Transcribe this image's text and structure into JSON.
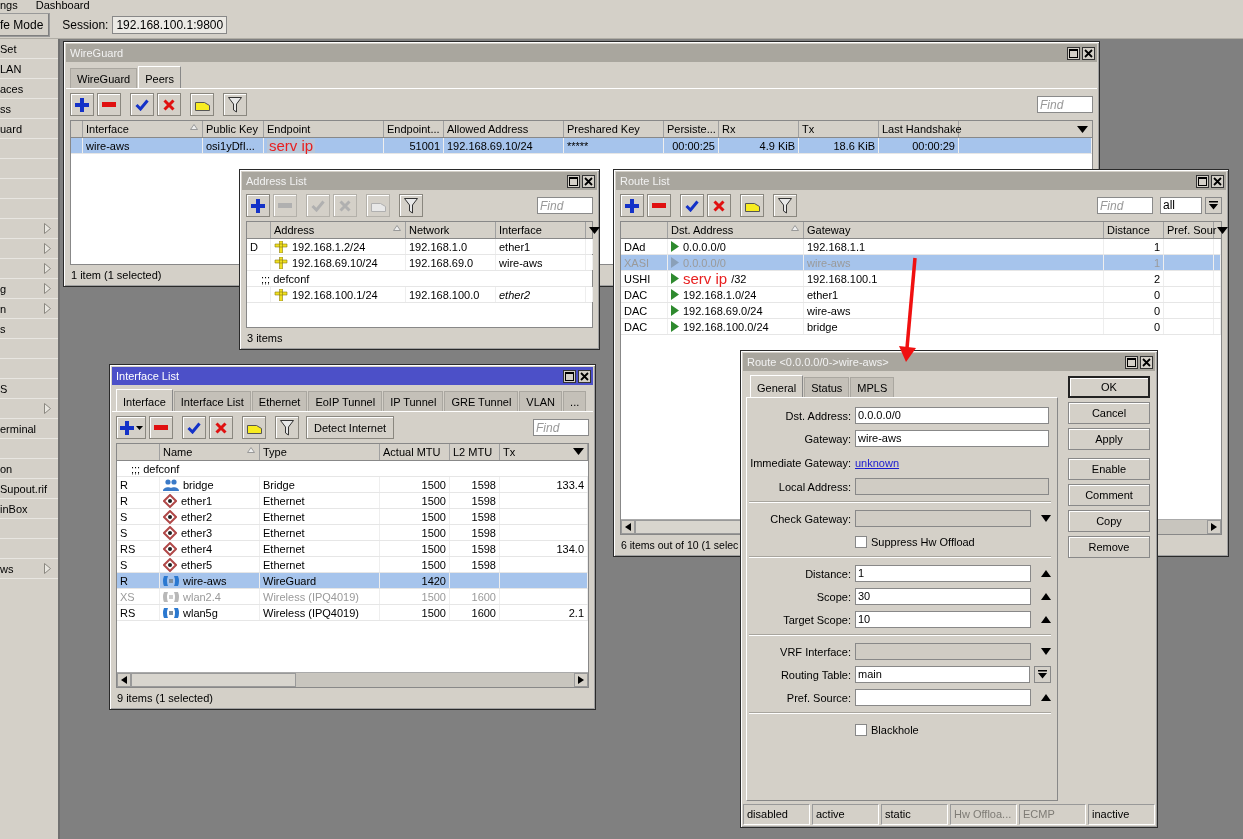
{
  "menu_bar": [
    "ngs",
    "Dashboard"
  ],
  "toolbar": {
    "safe_mode": "fe Mode",
    "session_label": "Session:",
    "session": "192.168.100.1:9800"
  },
  "sidebar": {
    "items": [
      {
        "label": "Set",
        "submenu": false
      },
      {
        "label": "LAN",
        "submenu": false
      },
      {
        "label": "aces",
        "submenu": false
      },
      {
        "label": "ss",
        "submenu": false
      },
      {
        "label": "uard",
        "submenu": false
      },
      {
        "submenu": false
      },
      {
        "submenu": false
      },
      {
        "submenu": false
      },
      {
        "submenu": false
      },
      {
        "submenu": true
      },
      {
        "submenu": true
      },
      {
        "submenu": true
      },
      {
        "label": "g",
        "submenu": true
      },
      {
        "label": "n",
        "submenu": true
      },
      {
        "label": "s",
        "submenu": false
      },
      {
        "submenu": false
      },
      {
        "submenu": false
      },
      {
        "label": "S",
        "submenu": false
      },
      {
        "submenu": true
      },
      {
        "label": "erminal",
        "submenu": false
      },
      {
        "submenu": false
      },
      {
        "label": "on",
        "submenu": false
      },
      {
        "label": "Supout.rif",
        "submenu": false
      },
      {
        "label": "inBox",
        "submenu": false
      },
      {
        "submenu": false
      },
      {
        "submenu": false
      },
      {
        "label": "ws",
        "submenu": true
      }
    ]
  },
  "wireguard_window": {
    "title": "WireGuard",
    "active": false,
    "tabs": [
      {
        "label": "WireGuard",
        "selected": false
      },
      {
        "label": "Peers",
        "selected": true
      }
    ],
    "toolbar": [
      {
        "kind": "add",
        "disabled": false
      },
      {
        "kind": "remove",
        "disabled": false
      },
      {
        "kind": "enable",
        "disabled": false
      },
      {
        "kind": "disable",
        "disabled": false
      },
      {
        "kind": "comment",
        "disabled": false
      },
      {
        "kind": "filter",
        "disabled": false
      }
    ],
    "find": {
      "placeholder": "Find"
    },
    "columns": [
      {
        "label": "Interface",
        "sorted": true
      },
      {
        "label": "Public Key",
        "sorted": false
      },
      {
        "label": "Endpoint",
        "sorted": false
      },
      {
        "label": "Endpoint...",
        "sorted": false
      },
      {
        "label": "Allowed Address",
        "sorted": false
      },
      {
        "label": "Preshared Key",
        "sorted": false
      },
      {
        "label": "Persiste...",
        "sorted": false
      },
      {
        "label": "Rx",
        "sorted": false
      },
      {
        "label": "Tx",
        "sorted": false
      },
      {
        "label": "Last Handshake",
        "sorted": false
      }
    ],
    "rows": [
      {
        "selected": true,
        "interface": "wire-aws",
        "public_key": "osi1yDfI...",
        "endpoint_annotation": "serv ip",
        "endpoint_port": "51001",
        "allowed_address": "192.168.69.10/24",
        "preshared_key": "*****",
        "persistent_keepalive": "00:00:25",
        "rx": "4.9 KiB",
        "tx": "18.6 KiB",
        "last_handshake": "00:00:29"
      }
    ],
    "status": "1 item (1 selected)"
  },
  "address_list_window": {
    "title": "Address List",
    "active": false,
    "toolbar": [
      {
        "kind": "add",
        "disabled": false
      },
      {
        "kind": "remove",
        "disabled": true
      },
      {
        "kind": "enable",
        "disabled": true
      },
      {
        "kind": "disable",
        "disabled": true
      },
      {
        "kind": "comment",
        "disabled": true
      },
      {
        "kind": "filter",
        "disabled": false
      }
    ],
    "find": {
      "placeholder": "Find"
    },
    "columns": [
      {
        "label": "Address",
        "sorted": true
      },
      {
        "label": "Network",
        "sorted": false
      },
      {
        "label": "Interface",
        "sorted": false
      }
    ],
    "rows": [
      {
        "kind": "entry",
        "flag": "D",
        "address": "192.168.1.2/24",
        "network": "192.168.1.0",
        "interface": "ether1",
        "invalid": false
      },
      {
        "kind": "entry",
        "address": "192.168.69.10/24",
        "network": "192.168.69.0",
        "interface": "wire-aws",
        "invalid": false
      },
      {
        "kind": "comment",
        "text": ";;; defconf"
      },
      {
        "kind": "entry",
        "address": "192.168.100.1/24",
        "network": "192.168.100.0",
        "interface": "ether2",
        "invalid": true
      }
    ],
    "status": "3 items"
  },
  "route_list_window": {
    "title": "Route List",
    "active": false,
    "toolbar": [
      {
        "kind": "add",
        "disabled": false
      },
      {
        "kind": "remove",
        "disabled": false
      },
      {
        "kind": "enable",
        "disabled": false
      },
      {
        "kind": "disable",
        "disabled": false
      },
      {
        "kind": "comment",
        "disabled": false
      },
      {
        "kind": "filter",
        "disabled": false
      }
    ],
    "find": {
      "placeholder": "Find"
    },
    "filter": {
      "value": "all"
    },
    "columns": [
      {
        "label": "Dst. Address",
        "sorted": true
      },
      {
        "label": "Gateway",
        "sorted": false
      },
      {
        "label": "Distance",
        "sorted": false
      },
      {
        "label": "Pref. Sour",
        "sorted": false
      }
    ],
    "rows": [
      {
        "flags": "DAd",
        "dst": "0.0.0.0/0",
        "gateway": "192.168.1.1",
        "distance": "1",
        "selected": false,
        "disabled": false
      },
      {
        "flags": "XASI",
        "dst": "0.0.0.0/0",
        "gateway": "wire-aws",
        "distance": "1",
        "selected": true,
        "disabled": true
      },
      {
        "flags": "USHI",
        "dst_annotation": "serv ip",
        "dst": "/32",
        "gateway": "192.168.100.1",
        "distance": "2",
        "selected": false,
        "disabled": false
      },
      {
        "flags": "DAC",
        "dst": "192.168.1.0/24",
        "gateway": "ether1",
        "distance": "0",
        "selected": false,
        "disabled": false
      },
      {
        "flags": "DAC",
        "dst": "192.168.69.0/24",
        "gateway": "wire-aws",
        "distance": "0",
        "selected": false,
        "disabled": false
      },
      {
        "flags": "DAC",
        "dst": "192.168.100.0/24",
        "gateway": "bridge",
        "distance": "0",
        "selected": false,
        "disabled": false
      }
    ],
    "status": "6 items out of 10 (1 selec"
  },
  "interface_list_window": {
    "title": "Interface List",
    "active": true,
    "tabs": [
      {
        "label": "Interface",
        "selected": true
      },
      {
        "label": "Interface List",
        "selected": false
      },
      {
        "label": "Ethernet",
        "selected": false
      },
      {
        "label": "EoIP Tunnel",
        "selected": false
      },
      {
        "label": "IP Tunnel",
        "selected": false
      },
      {
        "label": "GRE Tunnel",
        "selected": false
      },
      {
        "label": "VLAN",
        "selected": false
      },
      {
        "label": "...",
        "selected": false
      }
    ],
    "toolbar": [
      {
        "kind": "add",
        "disabled": false
      },
      {
        "kind": "remove",
        "disabled": false
      },
      {
        "kind": "enable",
        "disabled": false
      },
      {
        "kind": "disable",
        "disabled": false
      },
      {
        "kind": "comment",
        "disabled": false
      },
      {
        "kind": "filter",
        "disabled": false
      }
    ],
    "detect_button": "Detect Internet",
    "find": {
      "placeholder": "Find"
    },
    "columns": [
      {
        "label": "Name",
        "sorted": true
      },
      {
        "label": "Type",
        "sorted": false
      },
      {
        "label": "Actual MTU",
        "sorted": false
      },
      {
        "label": "L2 MTU",
        "sorted": false
      },
      {
        "label": "Tx",
        "sorted": false
      }
    ],
    "rows": [
      {
        "kind": "comment",
        "text": ";;; defconf"
      },
      {
        "kind": "bridge",
        "flags": "R",
        "name": "bridge",
        "type": "Bridge",
        "actual_mtu": "1500",
        "l2_mtu": "1598",
        "tx": "133.4",
        "selected": false,
        "disabled": false
      },
      {
        "kind": "ethernet",
        "flags": "R",
        "name": "ether1",
        "type": "Ethernet",
        "actual_mtu": "1500",
        "l2_mtu": "1598",
        "selected": false,
        "disabled": false
      },
      {
        "kind": "ethernet",
        "flags": "S",
        "name": "ether2",
        "type": "Ethernet",
        "actual_mtu": "1500",
        "l2_mtu": "1598",
        "selected": false,
        "disabled": false
      },
      {
        "kind": "ethernet",
        "flags": "S",
        "name": "ether3",
        "type": "Ethernet",
        "actual_mtu": "1500",
        "l2_mtu": "1598",
        "selected": false,
        "disabled": false
      },
      {
        "kind": "ethernet",
        "flags": "RS",
        "name": "ether4",
        "type": "Ethernet",
        "actual_mtu": "1500",
        "l2_mtu": "1598",
        "tx": "134.0",
        "selected": false,
        "disabled": false
      },
      {
        "kind": "ethernet",
        "flags": "S",
        "name": "ether5",
        "type": "Ethernet",
        "actual_mtu": "1500",
        "l2_mtu": "1598",
        "selected": false,
        "disabled": false
      },
      {
        "kind": "wireless",
        "flags": "R",
        "name": "wire-aws",
        "type": "WireGuard",
        "actual_mtu": "1420",
        "selected": true,
        "disabled": false
      },
      {
        "kind": "wireless",
        "flags": "XS",
        "name": "wlan2.4",
        "type": "Wireless (IPQ4019)",
        "actual_mtu": "1500",
        "l2_mtu": "1600",
        "selected": false,
        "disabled": true
      },
      {
        "kind": "wireless",
        "flags": "RS",
        "name": "wlan5g",
        "type": "Wireless (IPQ4019)",
        "actual_mtu": "1500",
        "l2_mtu": "1600",
        "tx": "2.1",
        "selected": false,
        "disabled": false
      }
    ],
    "status": "9 items (1 selected)"
  },
  "route_dialog": {
    "title": "Route <0.0.0.0/0->wire-aws>",
    "active": false,
    "tabs": [
      {
        "label": "General",
        "selected": true
      },
      {
        "label": "Status",
        "selected": false
      },
      {
        "label": "MPLS",
        "selected": false
      }
    ],
    "form": [
      {
        "kind": "text",
        "label": "Dst. Address:",
        "value": "0.0.0.0/0"
      },
      {
        "kind": "text",
        "label": "Gateway:",
        "value": "wire-aws"
      },
      {
        "kind": "link",
        "label": "Immediate Gateway:",
        "value": "unknown"
      },
      {
        "kind": "readonly",
        "label": "Local Address:"
      },
      {
        "kind": "separator"
      },
      {
        "kind": "select-readonly",
        "label": "Check Gateway:"
      },
      {
        "kind": "checkbox",
        "label": "Suppress Hw Offload",
        "checked": false
      },
      {
        "kind": "separator"
      },
      {
        "kind": "spin",
        "label": "Distance:",
        "value": "1"
      },
      {
        "kind": "spin",
        "label": "Scope:",
        "value": "30"
      },
      {
        "kind": "spin",
        "label": "Target Scope:",
        "value": "10"
      },
      {
        "kind": "separator"
      },
      {
        "kind": "select-readonly",
        "label": "VRF Interface:"
      },
      {
        "kind": "combo",
        "label": "Routing Table:",
        "value": "main"
      },
      {
        "kind": "spin",
        "label": "Pref. Source:"
      },
      {
        "kind": "separator"
      },
      {
        "kind": "checkbox",
        "label": "Blackhole",
        "checked": false
      }
    ],
    "buttons": [
      {
        "label": "OK",
        "default": true
      },
      {
        "label": "Cancel",
        "default": false
      },
      {
        "label": "Apply",
        "default": false
      },
      {
        "label": "Enable",
        "default": false
      },
      {
        "label": "Comment",
        "default": false
      },
      {
        "label": "Copy",
        "default": false
      },
      {
        "label": "Remove",
        "default": false
      }
    ],
    "status_bar": [
      {
        "text": "disabled",
        "disabled": false
      },
      {
        "text": "active",
        "disabled": false
      },
      {
        "text": "static",
        "disabled": false
      },
      {
        "text": "Hw Offloa...",
        "disabled": true
      },
      {
        "text": "ECMP",
        "disabled": true
      },
      {
        "text": "inactive",
        "disabled": false
      }
    ]
  }
}
